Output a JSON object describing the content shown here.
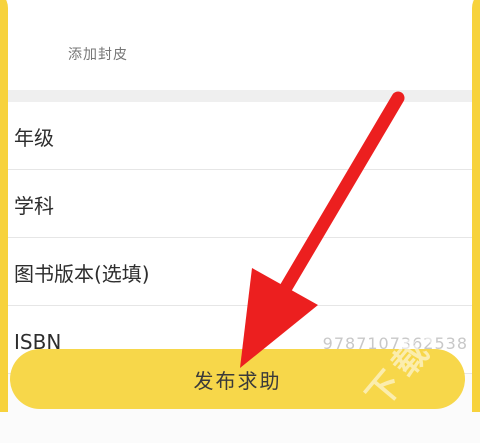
{
  "cover": {
    "label": "添加封皮"
  },
  "form": {
    "rows": [
      {
        "label": "年级",
        "value": ""
      },
      {
        "label": "学科",
        "value": ""
      },
      {
        "label": "图书版本(选填)",
        "value": ""
      },
      {
        "label": "ISBN",
        "value": "9787107362538"
      }
    ]
  },
  "submit": {
    "label": "发布求助"
  },
  "annotation": {
    "arrow_color": "#ec1f1f"
  },
  "watermark": {
    "text": "下载吧"
  },
  "colors": {
    "accent_yellow": "#f7d74a",
    "background": "#fbfbfb"
  }
}
